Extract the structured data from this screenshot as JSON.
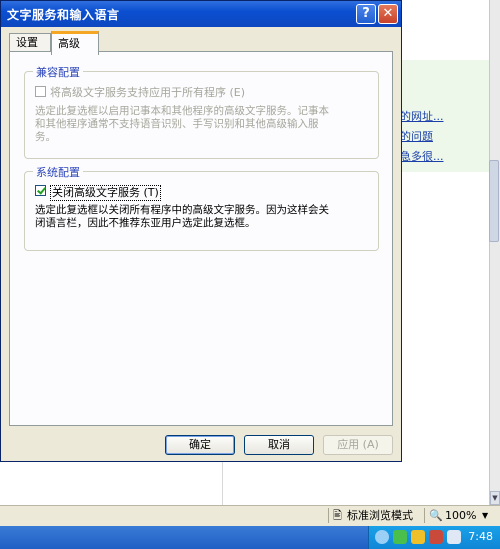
{
  "dialog": {
    "title": "文字服务和输入语言",
    "help_glyph": "?",
    "close_glyph": "✕",
    "tabs": [
      {
        "label": "设置",
        "active": false
      },
      {
        "label": "高级",
        "active": true
      }
    ],
    "compat_group": {
      "title": "兼容配置",
      "checkbox_label": "将高级文字服务支持应用于所有程序 (E)",
      "checkbox_checked": false,
      "checkbox_enabled": false,
      "description_line1": "选定此复选框以启用记事本和其他程序的高级文字服务。记事本",
      "description_line2": "和其他程序通常不支持语音识别、手写识别和其他高级输入服",
      "description_line3": "务。"
    },
    "system_group": {
      "title": "系统配置",
      "checkbox_label": "关闭高级文字服务 (T)",
      "checkbox_checked": true,
      "description_line1": "选定此复选框以关闭所有程序中的高级文字服务。因为这样会关",
      "description_line2": "闭语言栏，因此不推荐东亚用户选定此复选框。"
    },
    "buttons": {
      "ok": "确定",
      "cancel": "取消",
      "apply": "应用 (A)"
    }
  },
  "background": {
    "links": [
      "的网址...",
      "的问题",
      "急多很..."
    ]
  },
  "statusbar": {
    "mode": "标准浏览模式",
    "zoom": "100%"
  },
  "taskbar": {
    "clock": "7:48"
  },
  "colors": {
    "titlebar": "#0b4fd0",
    "dialog_bg": "#ece9d8",
    "group_title": "#2c45b8",
    "tab_highlight": "#f5a623",
    "link": "#1a3fa8"
  }
}
